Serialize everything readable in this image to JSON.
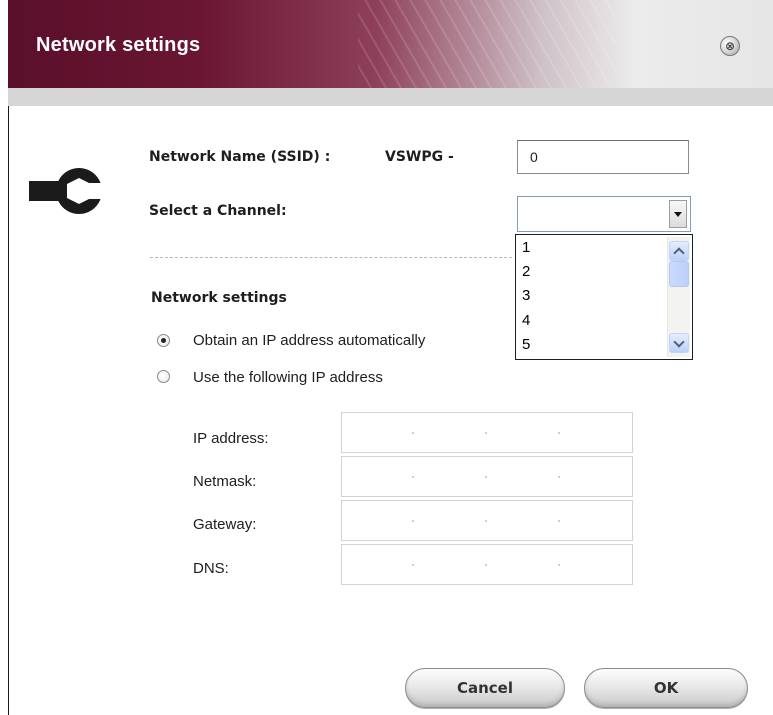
{
  "window": {
    "title": "Network settings",
    "close_icon": "x-circle-icon",
    "close_glyph": "⊗"
  },
  "wireless": {
    "ssid_label": "Network Name (SSID) :",
    "ssid_prefix": "VSWPG -",
    "ssid_value": "0",
    "channel_label": "Select a Channel:",
    "channel_selected": "",
    "channel_options_visible": [
      "1",
      "2",
      "3",
      "4",
      "5"
    ]
  },
  "network": {
    "heading": "Network settings",
    "mode_auto_label": "Obtain an IP address automatically",
    "mode_manual_label": "Use the following IP address",
    "selected_mode": "auto",
    "ip_label": "IP address:",
    "netmask_label": "Netmask:",
    "gateway_label": "Gateway:",
    "dns_label": "DNS:"
  },
  "buttons": {
    "cancel": "Cancel",
    "ok": "OK"
  },
  "colors": {
    "title_bar": "#5a0f2a",
    "list_border": "#1e1e1e",
    "scrollbar_accent": "#bcd0f6"
  }
}
